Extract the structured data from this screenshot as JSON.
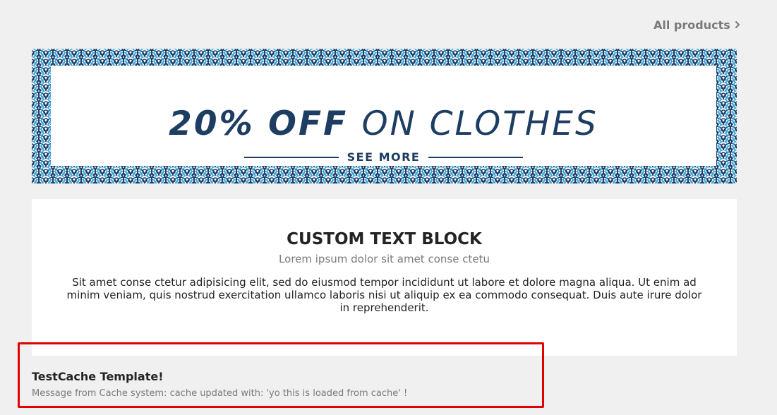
{
  "nav": {
    "all_products_label": "All products",
    "all_products_icon": "chevron-right-icon"
  },
  "banner": {
    "headline_bold": "20% OFF",
    "headline_light": "ON CLOTHES",
    "cta_label": "SEE MORE",
    "colors": {
      "text": "#1e3d62",
      "pattern_dark": "#1e3d62",
      "pattern_light": "#3aa7dd",
      "pattern_bg": "#ffffff"
    }
  },
  "custom_block": {
    "title": "CUSTOM TEXT BLOCK",
    "subtitle": "Lorem ipsum dolor sit amet conse ctetu",
    "body": "Sit amet conse ctetur adipisicing elit, sed do eiusmod tempor incididunt ut labore et dolore magna aliqua. Ut enim ad minim veniam, quis nostrud exercitation ullamco laboris nisi ut aliquip ex ea commodo consequat. Duis aute irure dolor in reprehenderit."
  },
  "testcache": {
    "title": "TestCache Template!",
    "message": "Message from Cache system: cache updated with: 'yo this is loaded from cache' !",
    "highlight_color": "#e00000"
  }
}
